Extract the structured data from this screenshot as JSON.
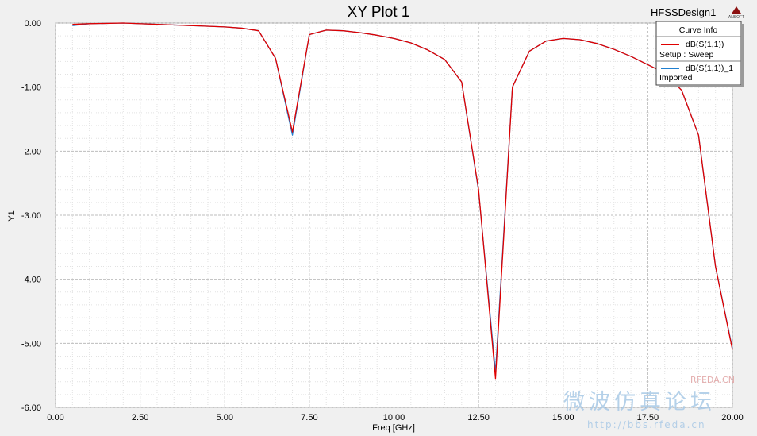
{
  "header": {
    "title": "XY Plot 1",
    "design_name": "HFSSDesign1",
    "logo_text": "ANSOFT"
  },
  "legend": {
    "title": "Curve Info",
    "entries": [
      {
        "line1": "dB(S(1,1))",
        "line2": "Setup : Sweep",
        "color": "#e00000"
      },
      {
        "line1": "dB(S(1,1))_1",
        "line2": "Imported",
        "color": "#1f7fd0"
      }
    ]
  },
  "watermark": {
    "line1": "RFEDA.CN",
    "line2": "微波仿真论坛",
    "line3": "http://bbs.rfeda.cn"
  },
  "chart_data": {
    "type": "line",
    "title": "XY Plot 1",
    "xlabel": "Freq [GHz]",
    "ylabel": "Y1",
    "xlim": [
      0,
      20
    ],
    "ylim": [
      -6,
      0
    ],
    "grid": true,
    "legend_position": "top-right",
    "x_ticks": [
      "0.00",
      "2.50",
      "5.00",
      "7.50",
      "10.00",
      "12.50",
      "15.00",
      "17.50",
      "20.00"
    ],
    "y_ticks": [
      "0.00",
      "-1.00",
      "-2.00",
      "-3.00",
      "-4.00",
      "-5.00",
      "-6.00"
    ],
    "series": [
      {
        "name": "dB(S(1,1))",
        "color": "#e00000",
        "x": [
          0.5,
          1,
          2,
          3,
          4,
          5,
          5.5,
          6,
          6.5,
          7,
          7.5,
          8,
          8.5,
          9,
          9.5,
          10,
          10.5,
          11,
          11.5,
          12,
          12.5,
          13,
          13.5,
          14,
          14.5,
          15,
          15.5,
          16,
          16.5,
          17,
          17.5,
          18,
          18.5,
          19,
          19.5,
          20
        ],
        "y": [
          -0.02,
          -0.01,
          0,
          -0.02,
          -0.04,
          -0.06,
          -0.08,
          -0.12,
          -0.55,
          -1.7,
          -0.18,
          -0.11,
          -0.12,
          -0.15,
          -0.19,
          -0.24,
          -0.31,
          -0.42,
          -0.57,
          -0.92,
          -2.6,
          -5.55,
          -1.0,
          -0.44,
          -0.28,
          -0.24,
          -0.26,
          -0.32,
          -0.41,
          -0.52,
          -0.65,
          -0.78,
          -1.05,
          -1.75,
          -3.8,
          -5.1
        ]
      },
      {
        "name": "dB(S(1,1))_1",
        "color": "#1f7fd0",
        "x": [
          0.5,
          1,
          2,
          3,
          4,
          5,
          5.5,
          6,
          6.5,
          7,
          7.5,
          8,
          8.5,
          9,
          9.5,
          10,
          10.5,
          11,
          11.5,
          12,
          12.5,
          13,
          13.5,
          14,
          14.5,
          15,
          15.5,
          16,
          16.5,
          17,
          17.5,
          18,
          18.5,
          19,
          19.5,
          20
        ],
        "y": [
          -0.04,
          -0.01,
          0,
          -0.02,
          -0.04,
          -0.06,
          -0.08,
          -0.12,
          -0.55,
          -1.75,
          -0.18,
          -0.11,
          -0.12,
          -0.15,
          -0.19,
          -0.24,
          -0.31,
          -0.42,
          -0.57,
          -0.92,
          -2.62,
          -5.45,
          -1.0,
          -0.44,
          -0.28,
          -0.24,
          -0.26,
          -0.32,
          -0.41,
          -0.52,
          -0.65,
          -0.78,
          -1.05,
          -1.75,
          -3.8,
          -5.08
        ]
      }
    ]
  }
}
